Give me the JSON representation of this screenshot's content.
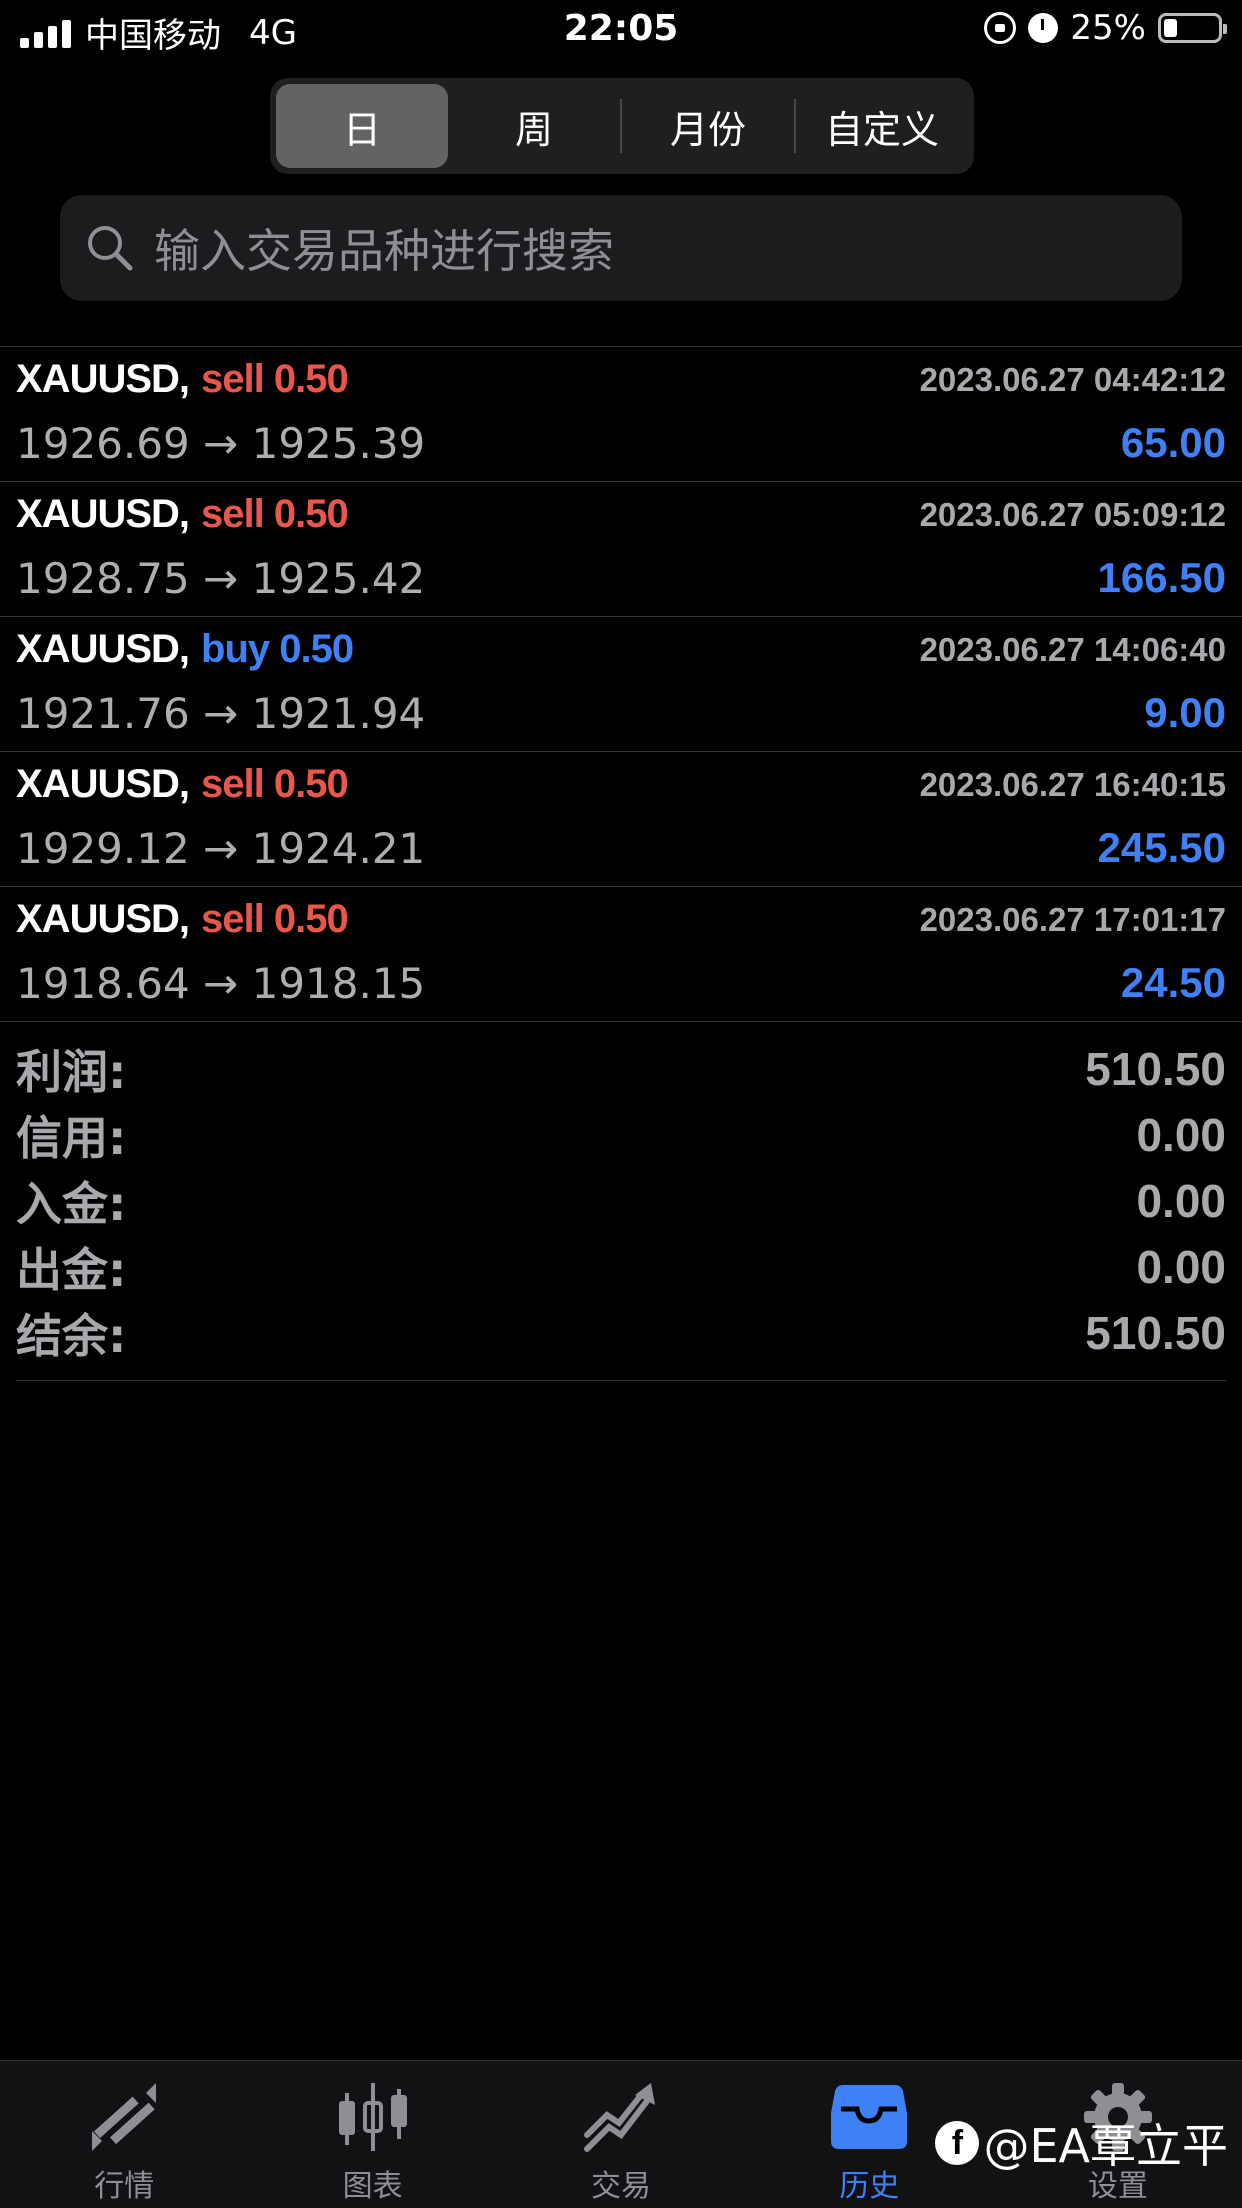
{
  "status_bar": {
    "carrier": "中国移动",
    "network": "4G",
    "time": "22:05",
    "battery": "25%",
    "battery_level": 0.25
  },
  "segments": {
    "items": [
      {
        "label": "日",
        "active": true
      },
      {
        "label": "周",
        "active": false
      },
      {
        "label": "月份",
        "active": false
      },
      {
        "label": "自定义",
        "active": false
      }
    ]
  },
  "search": {
    "placeholder": "输入交易品种进行搜索"
  },
  "trades": [
    {
      "symbol": "XAUUSD,",
      "side": "sell",
      "volume": "0.50",
      "time": "2023.06.27 04:42:12",
      "open": "1926.69",
      "close": "1925.39",
      "profit": "65.00"
    },
    {
      "symbol": "XAUUSD,",
      "side": "sell",
      "volume": "0.50",
      "time": "2023.06.27 05:09:12",
      "open": "1928.75",
      "close": "1925.42",
      "profit": "166.50"
    },
    {
      "symbol": "XAUUSD,",
      "side": "buy",
      "volume": "0.50",
      "time": "2023.06.27 14:06:40",
      "open": "1921.76",
      "close": "1921.94",
      "profit": "9.00"
    },
    {
      "symbol": "XAUUSD,",
      "side": "sell",
      "volume": "0.50",
      "time": "2023.06.27 16:40:15",
      "open": "1929.12",
      "close": "1924.21",
      "profit": "245.50"
    },
    {
      "symbol": "XAUUSD,",
      "side": "sell",
      "volume": "0.50",
      "time": "2023.06.27 17:01:17",
      "open": "1918.64",
      "close": "1918.15",
      "profit": "24.50"
    }
  ],
  "summary": [
    {
      "label": "利润:",
      "value": "510.50"
    },
    {
      "label": "信用:",
      "value": "0.00"
    },
    {
      "label": "入金:",
      "value": "0.00"
    },
    {
      "label": "出金:",
      "value": "0.00"
    },
    {
      "label": "结余:",
      "value": "510.50"
    }
  ],
  "tabbar": {
    "items": [
      {
        "label": "行情",
        "icon": "quotes-arrows-icon",
        "active": false
      },
      {
        "label": "图表",
        "icon": "candlestick-chart-icon",
        "active": false
      },
      {
        "label": "交易",
        "icon": "trade-trend-icon",
        "active": false
      },
      {
        "label": "历史",
        "icon": "inbox-tray-icon",
        "active": true
      },
      {
        "label": "设置",
        "icon": "gear-icon",
        "active": false
      }
    ]
  },
  "watermark": {
    "text": "@EA覃立平"
  },
  "colors": {
    "sell": "#e8574b",
    "buy": "#3f80f5",
    "profit": "#3f80f5",
    "active_tab": "#3f80f5"
  }
}
